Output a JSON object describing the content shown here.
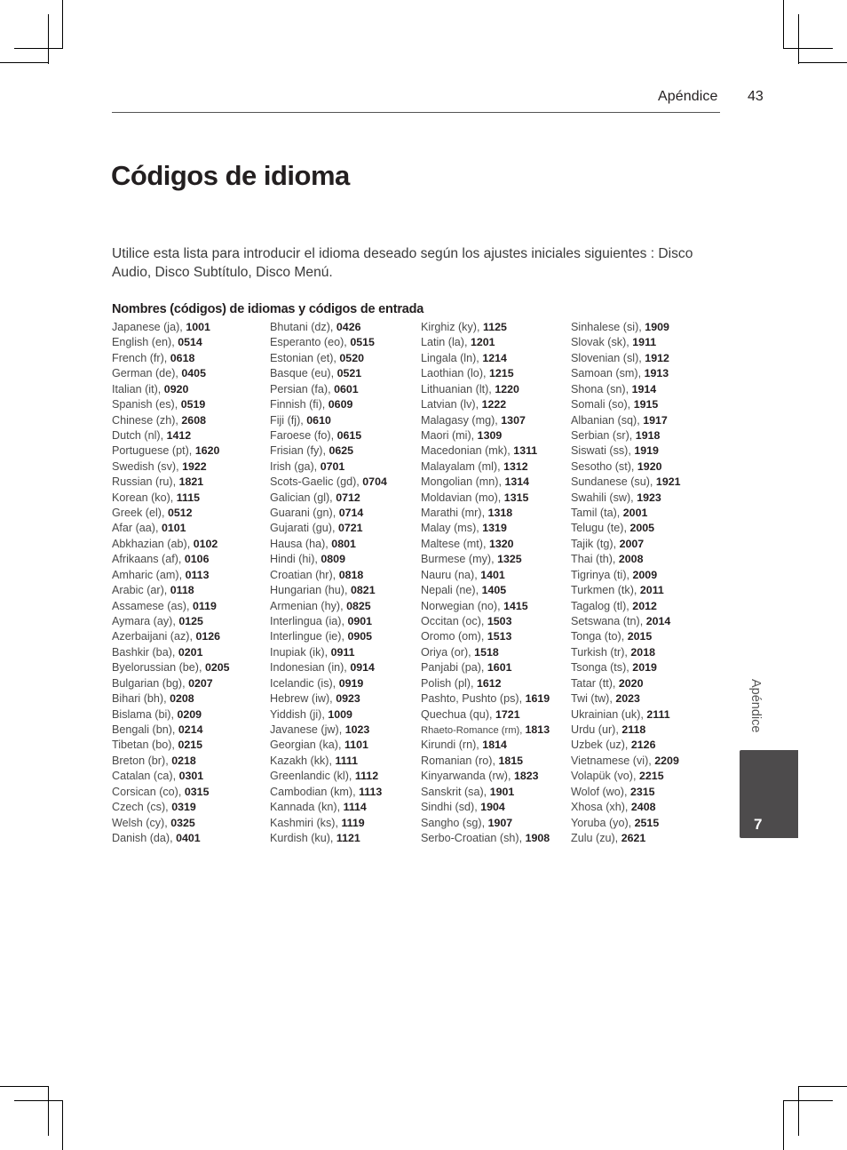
{
  "header": {
    "section": "Apéndice",
    "page_number": "43"
  },
  "title": "Códigos de idioma",
  "intro": "Utilice esta lista para introducir el idioma deseado según los ajustes iniciales siguientes : Disco Audio, Disco Subtítulo, Disco Menú.",
  "list_heading": "Nombres (códigos) de idiomas y códigos de entrada",
  "columns": [
    [
      {
        "name": "Japanese (ja), ",
        "code": "1001"
      },
      {
        "name": "English (en), ",
        "code": "0514"
      },
      {
        "name": "French (fr), ",
        "code": "0618"
      },
      {
        "name": "German (de), ",
        "code": "0405"
      },
      {
        "name": "Italian (it), ",
        "code": "0920"
      },
      {
        "name": "Spanish (es), ",
        "code": "0519"
      },
      {
        "name": "Chinese (zh), ",
        "code": "2608"
      },
      {
        "name": "Dutch (nl), ",
        "code": "1412"
      },
      {
        "name": "Portuguese (pt), ",
        "code": "1620"
      },
      {
        "name": "Swedish (sv), ",
        "code": "1922"
      },
      {
        "name": "Russian (ru), ",
        "code": "1821"
      },
      {
        "name": "Korean (ko), ",
        "code": "1115"
      },
      {
        "name": "Greek (el), ",
        "code": "0512"
      },
      {
        "name": "Afar (aa), ",
        "code": "0101"
      },
      {
        "name": "Abkhazian (ab), ",
        "code": "0102"
      },
      {
        "name": "Afrikaans (af), ",
        "code": "0106"
      },
      {
        "name": "Amharic (am), ",
        "code": "0113"
      },
      {
        "name": "Arabic (ar), ",
        "code": "0118"
      },
      {
        "name": "Assamese (as), ",
        "code": "0119"
      },
      {
        "name": "Aymara (ay), ",
        "code": "0125"
      },
      {
        "name": "Azerbaijani (az), ",
        "code": "0126"
      },
      {
        "name": "Bashkir (ba), ",
        "code": "0201"
      },
      {
        "name": "Byelorussian (be), ",
        "code": "0205"
      },
      {
        "name": "Bulgarian (bg), ",
        "code": "0207"
      },
      {
        "name": "Bihari (bh), ",
        "code": "0208"
      },
      {
        "name": "Bislama (bi), ",
        "code": "0209"
      },
      {
        "name": "Bengali (bn), ",
        "code": "0214"
      },
      {
        "name": "Tibetan (bo), ",
        "code": "0215"
      },
      {
        "name": "Breton (br), ",
        "code": "0218"
      },
      {
        "name": "Catalan (ca), ",
        "code": "0301"
      },
      {
        "name": "Corsican (co), ",
        "code": "0315"
      },
      {
        "name": "Czech (cs), ",
        "code": "0319"
      },
      {
        "name": "Welsh (cy), ",
        "code": "0325"
      },
      {
        "name": "Danish (da), ",
        "code": "0401"
      }
    ],
    [
      {
        "name": "Bhutani (dz), ",
        "code": "0426"
      },
      {
        "name": "Esperanto (eo), ",
        "code": "0515"
      },
      {
        "name": "Estonian (et), ",
        "code": "0520"
      },
      {
        "name": "Basque (eu), ",
        "code": "0521"
      },
      {
        "name": "Persian (fa), ",
        "code": "0601"
      },
      {
        "name": "Finnish (fi), ",
        "code": "0609"
      },
      {
        "name": "Fiji (fj), ",
        "code": "0610"
      },
      {
        "name": "Faroese (fo), ",
        "code": "0615"
      },
      {
        "name": "Frisian (fy), ",
        "code": "0625"
      },
      {
        "name": "Irish (ga), ",
        "code": "0701"
      },
      {
        "name": "Scots-Gaelic (gd), ",
        "code": "0704"
      },
      {
        "name": "Galician (gl), ",
        "code": "0712"
      },
      {
        "name": "Guarani (gn), ",
        "code": "0714"
      },
      {
        "name": "Gujarati (gu), ",
        "code": "0721"
      },
      {
        "name": "Hausa (ha), ",
        "code": "0801"
      },
      {
        "name": "Hindi (hi), ",
        "code": "0809"
      },
      {
        "name": "Croatian (hr), ",
        "code": "0818"
      },
      {
        "name": "Hungarian (hu), ",
        "code": "0821"
      },
      {
        "name": "Armenian (hy), ",
        "code": "0825"
      },
      {
        "name": "Interlingua (ia), ",
        "code": "0901"
      },
      {
        "name": "Interlingue (ie), ",
        "code": "0905"
      },
      {
        "name": "Inupiak (ik), ",
        "code": "0911"
      },
      {
        "name": "Indonesian (in), ",
        "code": "0914"
      },
      {
        "name": "Icelandic (is), ",
        "code": "0919"
      },
      {
        "name": "Hebrew (iw), ",
        "code": "0923"
      },
      {
        "name": "Yiddish (ji), ",
        "code": "1009"
      },
      {
        "name": "Javanese (jw), ",
        "code": "1023"
      },
      {
        "name": "Georgian (ka), ",
        "code": "1101"
      },
      {
        "name": "Kazakh (kk), ",
        "code": "1111"
      },
      {
        "name": "Greenlandic (kl), ",
        "code": "1112"
      },
      {
        "name": "Cambodian (km), ",
        "code": "1113"
      },
      {
        "name": "Kannada (kn), ",
        "code": "1114"
      },
      {
        "name": "Kashmiri (ks), ",
        "code": "1119"
      },
      {
        "name": "Kurdish (ku), ",
        "code": "1121"
      }
    ],
    [
      {
        "name": "Kirghiz (ky), ",
        "code": "1125"
      },
      {
        "name": "Latin (la), ",
        "code": "1201"
      },
      {
        "name": "Lingala (ln), ",
        "code": "1214"
      },
      {
        "name": "Laothian (lo), ",
        "code": "1215"
      },
      {
        "name": "Lithuanian (lt), ",
        "code": "1220"
      },
      {
        "name": "Latvian (lv), ",
        "code": "1222"
      },
      {
        "name": "Malagasy (mg), ",
        "code": "1307"
      },
      {
        "name": "Maori (mi), ",
        "code": "1309"
      },
      {
        "name": "Macedonian (mk), ",
        "code": "1311"
      },
      {
        "name": "Malayalam (ml), ",
        "code": "1312"
      },
      {
        "name": "Mongolian (mn), ",
        "code": "1314"
      },
      {
        "name": "Moldavian (mo), ",
        "code": "1315"
      },
      {
        "name": "Marathi (mr), ",
        "code": "1318"
      },
      {
        "name": "Malay (ms), ",
        "code": "1319"
      },
      {
        "name": "Maltese (mt), ",
        "code": "1320"
      },
      {
        "name": "Burmese (my), ",
        "code": "1325"
      },
      {
        "name": "Nauru (na), ",
        "code": "1401"
      },
      {
        "name": "Nepali (ne), ",
        "code": "1405"
      },
      {
        "name": "Norwegian (no), ",
        "code": "1415"
      },
      {
        "name": "Occitan (oc), ",
        "code": "1503"
      },
      {
        "name": "Oromo (om), ",
        "code": "1513"
      },
      {
        "name": "Oriya (or), ",
        "code": "1518"
      },
      {
        "name": "Panjabi (pa), ",
        "code": "1601"
      },
      {
        "name": "Polish (pl), ",
        "code": "1612"
      },
      {
        "name": "Pashto, Pushto (ps), ",
        "code": "1619"
      },
      {
        "name": "Quechua (qu), ",
        "code": "1721"
      },
      {
        "name": "Rhaeto-Romance (rm), ",
        "code": "1813",
        "small": true
      },
      {
        "name": "Kirundi (rn), ",
        "code": "1814"
      },
      {
        "name": "Romanian (ro), ",
        "code": "1815"
      },
      {
        "name": "Kinyarwanda (rw), ",
        "code": "1823"
      },
      {
        "name": "Sanskrit (sa), ",
        "code": "1901"
      },
      {
        "name": "Sindhi (sd), ",
        "code": "1904"
      },
      {
        "name": "Sangho (sg), ",
        "code": "1907"
      },
      {
        "name": "Serbo-Croatian (sh), ",
        "code": "1908"
      }
    ],
    [
      {
        "name": "Sinhalese (si), ",
        "code": "1909"
      },
      {
        "name": "Slovak (sk), ",
        "code": "1911"
      },
      {
        "name": "Slovenian (sl), ",
        "code": "1912"
      },
      {
        "name": "Samoan (sm), ",
        "code": "1913"
      },
      {
        "name": "Shona (sn), ",
        "code": "1914"
      },
      {
        "name": "Somali (so), ",
        "code": "1915"
      },
      {
        "name": "Albanian (sq), ",
        "code": "1917"
      },
      {
        "name": "Serbian (sr), ",
        "code": "1918"
      },
      {
        "name": "Siswati (ss), ",
        "code": "1919"
      },
      {
        "name": "Sesotho (st), ",
        "code": "1920"
      },
      {
        "name": "Sundanese (su), ",
        "code": "1921"
      },
      {
        "name": "Swahili (sw), ",
        "code": "1923"
      },
      {
        "name": "Tamil (ta), ",
        "code": "2001"
      },
      {
        "name": "Telugu (te), ",
        "code": "2005"
      },
      {
        "name": "Tajik (tg), ",
        "code": "2007"
      },
      {
        "name": "Thai (th), ",
        "code": "2008"
      },
      {
        "name": "Tigrinya (ti), ",
        "code": "2009"
      },
      {
        "name": "Turkmen (tk), ",
        "code": "2011"
      },
      {
        "name": "Tagalog (tl), ",
        "code": "2012"
      },
      {
        "name": "Setswana (tn), ",
        "code": "2014"
      },
      {
        "name": "Tonga (to), ",
        "code": "2015"
      },
      {
        "name": "Turkish (tr), ",
        "code": "2018"
      },
      {
        "name": "Tsonga (ts), ",
        "code": "2019"
      },
      {
        "name": "Tatar (tt), ",
        "code": "2020"
      },
      {
        "name": "Twi (tw), ",
        "code": "2023"
      },
      {
        "name": "Ukrainian (uk), ",
        "code": "2111"
      },
      {
        "name": "Urdu (ur), ",
        "code": "2118"
      },
      {
        "name": "Uzbek (uz), ",
        "code": "2126"
      },
      {
        "name": "Vietnamese (vi), ",
        "code": "2209"
      },
      {
        "name": "Volapük (vo), ",
        "code": "2215"
      },
      {
        "name": "Wolof (wo), ",
        "code": "2315"
      },
      {
        "name": "Xhosa (xh), ",
        "code": "2408"
      },
      {
        "name": "Yoruba (yo), ",
        "code": "2515"
      },
      {
        "name": "Zulu (zu), ",
        "code": "2621"
      }
    ]
  ],
  "side_tab": {
    "label": "Apéndice",
    "chapter": "7"
  },
  "colors": {
    "text": "#231f20",
    "tab_background": "#4d4b4c",
    "tab_text": "#ffffff"
  }
}
